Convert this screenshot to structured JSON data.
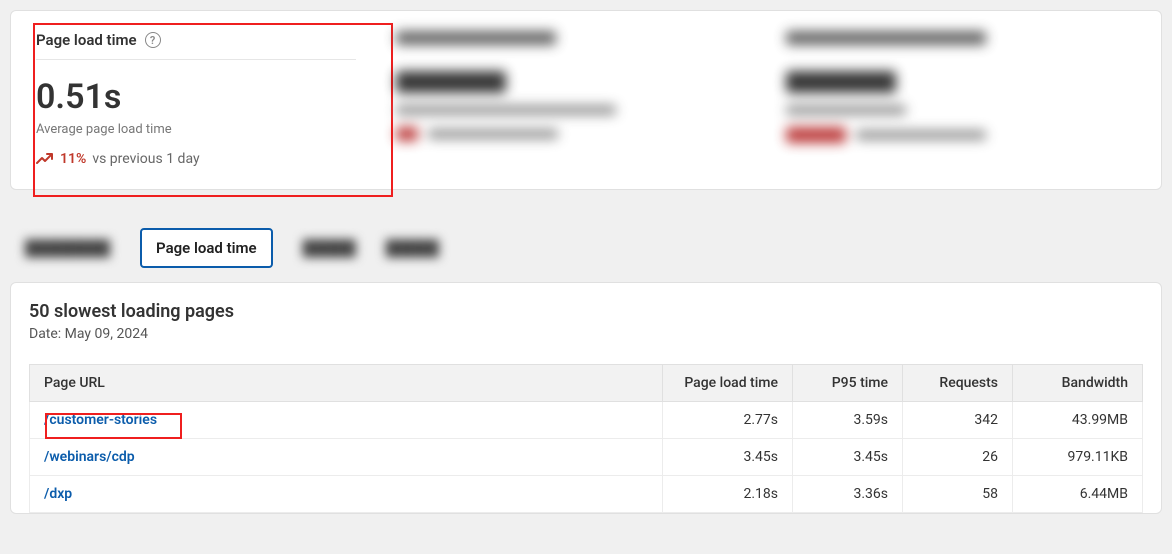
{
  "card": {
    "title": "Page load time",
    "value": "0.51s",
    "subtitle": "Average page load time",
    "delta_pct": "11%",
    "delta_cmp": "vs previous 1 day"
  },
  "tabs": {
    "active": "Page load time"
  },
  "panel": {
    "title": "50 slowest loading pages",
    "date_label": "Date: May 09, 2024"
  },
  "table": {
    "headers": {
      "url": "Page URL",
      "plt": "Page load time",
      "p95": "P95 time",
      "req": "Requests",
      "bw": "Bandwidth"
    },
    "rows": [
      {
        "url": "/customer-stories",
        "plt": "2.77s",
        "p95": "3.59s",
        "req": "342",
        "bw": "43.99MB"
      },
      {
        "url": "/webinars/cdp",
        "plt": "3.45s",
        "p95": "3.45s",
        "req": "26",
        "bw": "979.11KB"
      },
      {
        "url": "/dxp",
        "plt": "2.18s",
        "p95": "3.36s",
        "req": "58",
        "bw": "6.44MB"
      }
    ]
  }
}
